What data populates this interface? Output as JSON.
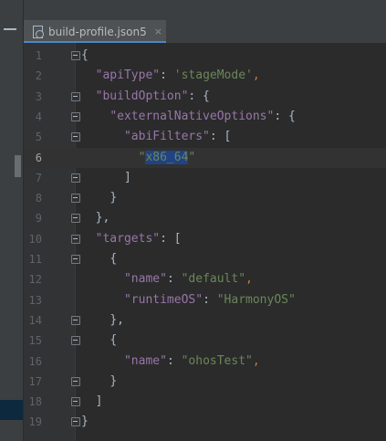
{
  "tab": {
    "filename": "build-profile.json5",
    "close_glyph": "×",
    "icon": "json5-file-icon"
  },
  "editor": {
    "current_line": 6,
    "lines": [
      {
        "num": "1",
        "tokens": [
          {
            "t": "{",
            "c": "p"
          }
        ]
      },
      {
        "num": "2",
        "tokens": [
          {
            "t": "  ",
            "c": "p"
          },
          {
            "t": "\"apiType\"",
            "c": "k"
          },
          {
            "t": ": ",
            "c": "p"
          },
          {
            "t": "'stageMode'",
            "c": "s"
          },
          {
            "t": ",",
            "c": "c"
          }
        ]
      },
      {
        "num": "3",
        "tokens": [
          {
            "t": "  ",
            "c": "p"
          },
          {
            "t": "\"buildOption\"",
            "c": "k"
          },
          {
            "t": ": {",
            "c": "p"
          }
        ]
      },
      {
        "num": "4",
        "tokens": [
          {
            "t": "    ",
            "c": "p"
          },
          {
            "t": "\"externalNativeOptions\"",
            "c": "k"
          },
          {
            "t": ": {",
            "c": "p"
          }
        ]
      },
      {
        "num": "5",
        "tokens": [
          {
            "t": "      ",
            "c": "p"
          },
          {
            "t": "\"abiFilters\"",
            "c": "k"
          },
          {
            "t": ": [",
            "c": "p"
          }
        ]
      },
      {
        "num": "6",
        "tokens": [
          {
            "t": "        ",
            "c": "p"
          },
          {
            "t": "\"",
            "c": "s"
          },
          {
            "t": "x86_64",
            "c": "hl"
          },
          {
            "t": "\"",
            "c": "s"
          }
        ]
      },
      {
        "num": "7",
        "tokens": [
          {
            "t": "      ",
            "c": "p"
          },
          {
            "t": "]",
            "c": "p"
          }
        ]
      },
      {
        "num": "8",
        "tokens": [
          {
            "t": "    ",
            "c": "p"
          },
          {
            "t": "}",
            "c": "p"
          }
        ]
      },
      {
        "num": "9",
        "tokens": [
          {
            "t": "  ",
            "c": "p"
          },
          {
            "t": "},",
            "c": "p"
          }
        ]
      },
      {
        "num": "10",
        "tokens": [
          {
            "t": "  ",
            "c": "p"
          },
          {
            "t": "\"targets\"",
            "c": "k"
          },
          {
            "t": ": [",
            "c": "p"
          }
        ]
      },
      {
        "num": "11",
        "tokens": [
          {
            "t": "    ",
            "c": "p"
          },
          {
            "t": "{",
            "c": "p"
          }
        ]
      },
      {
        "num": "12",
        "tokens": [
          {
            "t": "      ",
            "c": "p"
          },
          {
            "t": "\"name\"",
            "c": "k"
          },
          {
            "t": ": ",
            "c": "p"
          },
          {
            "t": "\"default\"",
            "c": "s"
          },
          {
            "t": ",",
            "c": "c"
          }
        ]
      },
      {
        "num": "13",
        "tokens": [
          {
            "t": "      ",
            "c": "p"
          },
          {
            "t": "\"runtimeOS\"",
            "c": "k"
          },
          {
            "t": ": ",
            "c": "p"
          },
          {
            "t": "\"HarmonyOS\"",
            "c": "s"
          }
        ]
      },
      {
        "num": "14",
        "tokens": [
          {
            "t": "    ",
            "c": "p"
          },
          {
            "t": "},",
            "c": "p"
          }
        ]
      },
      {
        "num": "15",
        "tokens": [
          {
            "t": "    ",
            "c": "p"
          },
          {
            "t": "{",
            "c": "p"
          }
        ]
      },
      {
        "num": "16",
        "tokens": [
          {
            "t": "      ",
            "c": "p"
          },
          {
            "t": "\"name\"",
            "c": "k"
          },
          {
            "t": ": ",
            "c": "p"
          },
          {
            "t": "\"ohosTest\"",
            "c": "s"
          },
          {
            "t": ",",
            "c": "c"
          }
        ]
      },
      {
        "num": "17",
        "tokens": [
          {
            "t": "    ",
            "c": "p"
          },
          {
            "t": "}",
            "c": "p"
          }
        ]
      },
      {
        "num": "18",
        "tokens": [
          {
            "t": "  ",
            "c": "p"
          },
          {
            "t": "]",
            "c": "p"
          }
        ]
      },
      {
        "num": "19",
        "tokens": [
          {
            "t": "}",
            "c": "p"
          }
        ]
      }
    ],
    "fold_markers": [
      1,
      3,
      4,
      5,
      7,
      8,
      9,
      10,
      11,
      14,
      15,
      17,
      18,
      19
    ]
  },
  "colors": {
    "background": "#2b2b2b",
    "gutter": "#313335",
    "key": "#9876aa",
    "string": "#6a8759",
    "punct": "#a9b7c6",
    "comma": "#cc7832",
    "selection": "#214283",
    "tab_underline": "#4a88c7"
  }
}
